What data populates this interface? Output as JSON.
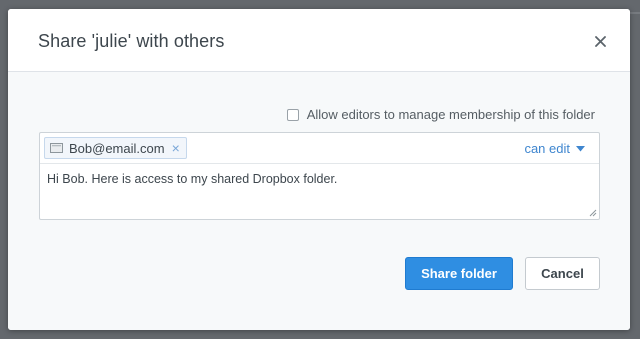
{
  "dialog": {
    "title": "Share 'julie' with others",
    "close_icon": "close-icon"
  },
  "options": {
    "allow_editors_label": "Allow editors to manage membership of this folder",
    "allow_editors_checked": false
  },
  "share": {
    "recipients": [
      {
        "email": "Bob@email.com",
        "icon": "mail-icon"
      }
    ],
    "permission_label": "can edit",
    "message_value": "Hi Bob. Here is access to my shared Dropbox folder."
  },
  "actions": {
    "share_label": "Share folder",
    "cancel_label": "Cancel"
  },
  "colors": {
    "primary": "#2f8ee2",
    "link": "#3f86cf",
    "chip_border": "#c6d8ec"
  }
}
